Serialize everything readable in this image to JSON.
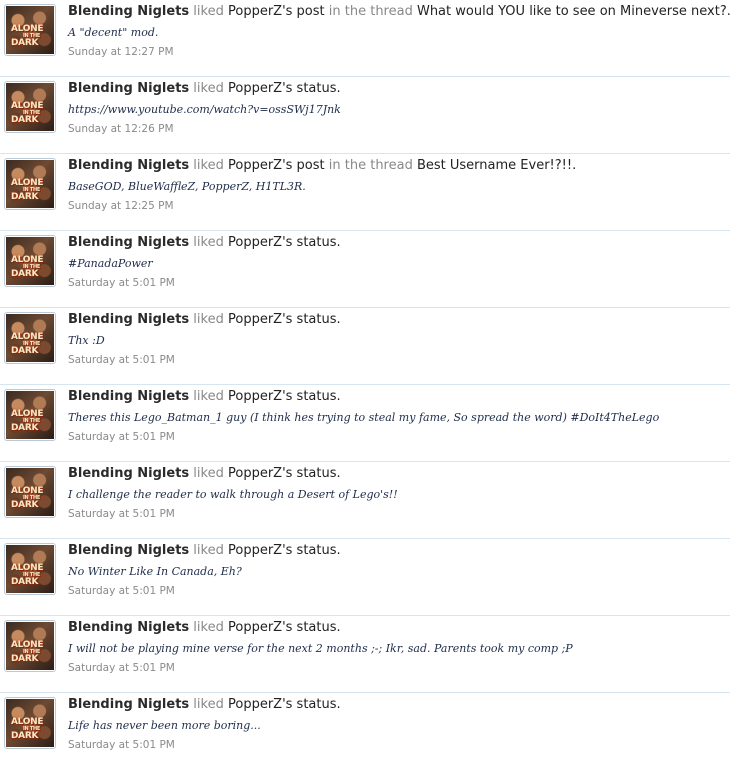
{
  "avatar_label": {
    "line1": "ALONE",
    "line2": "IN THE",
    "line3": "DARK"
  },
  "items": [
    {
      "user": "Blending Niglets",
      "verb": "liked",
      "target": "PopperZ's post",
      "connector": "in the thread",
      "thread": "What would YOU like to see on Mineverse next?.",
      "snippet": "A \"decent\" mod.",
      "time": "Sunday at 12:27 PM"
    },
    {
      "user": "Blending Niglets",
      "verb": "liked",
      "target": "PopperZ's status.",
      "connector": "",
      "thread": "",
      "snippet": "https://www.youtube.com/watch?v=ossSWj17Jnk",
      "time": "Sunday at 12:26 PM"
    },
    {
      "user": "Blending Niglets",
      "verb": "liked",
      "target": "PopperZ's post",
      "connector": "in the thread",
      "thread": "Best Username Ever!?!!.",
      "snippet": "BaseGOD, BlueWaffleZ, PopperZ, H1TL3R.",
      "time": "Sunday at 12:25 PM"
    },
    {
      "user": "Blending Niglets",
      "verb": "liked",
      "target": "PopperZ's status.",
      "connector": "",
      "thread": "",
      "snippet": "#PanadaPower",
      "time": "Saturday at 5:01 PM"
    },
    {
      "user": "Blending Niglets",
      "verb": "liked",
      "target": "PopperZ's status.",
      "connector": "",
      "thread": "",
      "snippet": "Thx :D",
      "time": "Saturday at 5:01 PM"
    },
    {
      "user": "Blending Niglets",
      "verb": "liked",
      "target": "PopperZ's status.",
      "connector": "",
      "thread": "",
      "snippet": "Theres this Lego_Batman_1 guy (I think hes trying to steal my fame, So spread the word) #DoIt4TheLego",
      "time": "Saturday at 5:01 PM"
    },
    {
      "user": "Blending Niglets",
      "verb": "liked",
      "target": "PopperZ's status.",
      "connector": "",
      "thread": "",
      "snippet": "I challenge the reader to walk through a Desert of Lego's!!",
      "time": "Saturday at 5:01 PM"
    },
    {
      "user": "Blending Niglets",
      "verb": "liked",
      "target": "PopperZ's status.",
      "connector": "",
      "thread": "",
      "snippet": "No Winter Like In Canada, Eh?",
      "time": "Saturday at 5:01 PM"
    },
    {
      "user": "Blending Niglets",
      "verb": "liked",
      "target": "PopperZ's status.",
      "connector": "",
      "thread": "",
      "snippet": "I will not be playing mine verse for the next 2 months ;-; Ikr, sad. Parents took my comp ;P",
      "time": "Saturday at 5:01 PM"
    },
    {
      "user": "Blending Niglets",
      "verb": "liked",
      "target": "PopperZ's status.",
      "connector": "",
      "thread": "",
      "snippet": "Life has never been more boring...",
      "time": "Saturday at 5:01 PM"
    }
  ]
}
